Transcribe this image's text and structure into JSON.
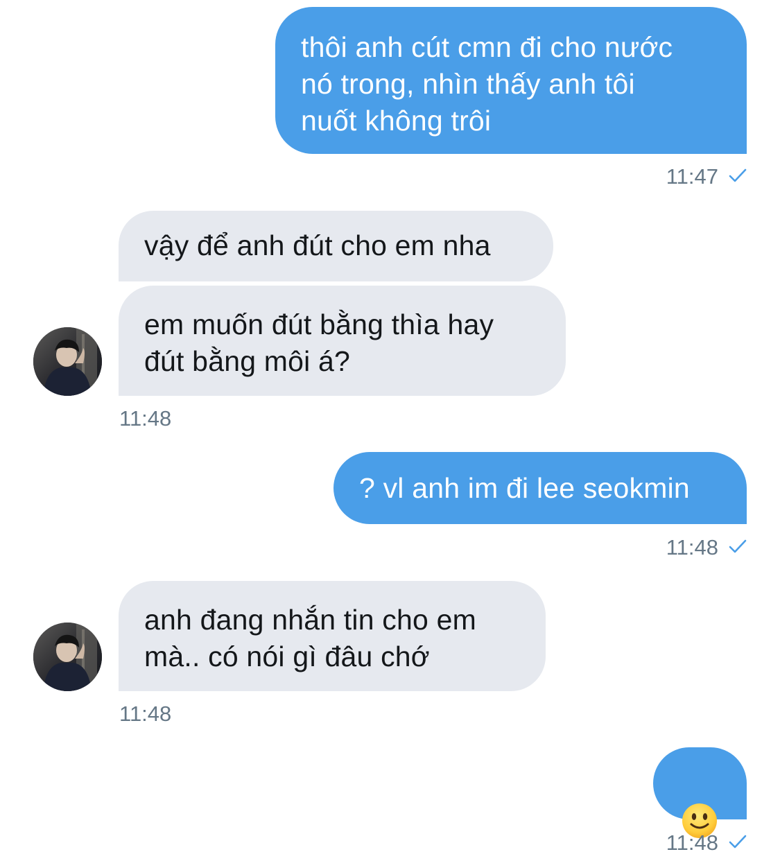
{
  "conversation": {
    "accent_color": "#4a9ee8",
    "incoming_bubble_color": "#e6e9ef",
    "messages": [
      {
        "direction": "outgoing",
        "text": "thôi anh cút cmn đi cho nước\nnó trong, nhìn thấy anh tôi\nnuốt không trôi",
        "time": "11:47",
        "status_icon": "sent-check-icon"
      },
      {
        "direction": "incoming",
        "text": "vậy để anh đút cho em nha"
      },
      {
        "direction": "incoming",
        "text": "em muốn đút bằng thìa hay\nđút bằng môi á?",
        "time": "11:48",
        "avatar": "contact-avatar"
      },
      {
        "direction": "outgoing",
        "text": "? vl anh im đi lee seokmin",
        "time": "11:48",
        "status_icon": "sent-check-icon"
      },
      {
        "direction": "incoming",
        "text": "anh đang nhắn tin cho em\nmà.. có nói gì đâu chớ",
        "time": "11:48",
        "avatar": "contact-avatar"
      },
      {
        "direction": "outgoing",
        "emoji": "slightly-smiling-face",
        "time": "11:48",
        "status_icon": "sent-check-icon"
      }
    ]
  }
}
